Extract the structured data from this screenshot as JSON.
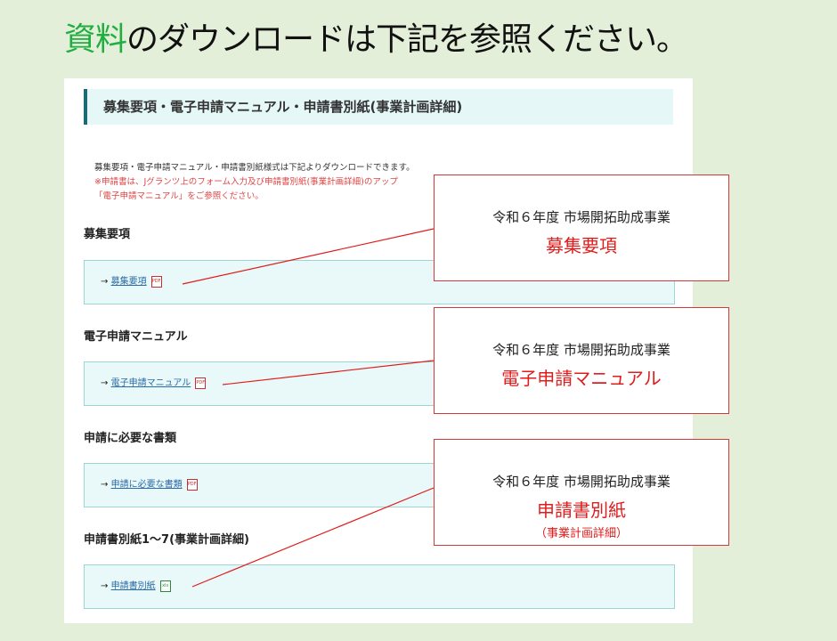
{
  "headline": {
    "accent": "資料",
    "rest": "のダウンロードは下記を参照ください。"
  },
  "panel": {
    "title": "募集要項・電子申請マニュアル・申請書別紙(事業計画詳細)",
    "intro_line1": "募集要項・電子申請マニュアル・申請書別紙様式は下記よりダウンロードできます。",
    "intro_line2": "※申請書は、Jグランツ上のフォーム入力及び申請書別紙(事業計画詳細)のアップ",
    "intro_line3": "「電子申請マニュアル」をご参照ください。",
    "groups": [
      {
        "heading": "募集要項",
        "arrow": "→",
        "link": "募集要項",
        "icon": "PDF"
      },
      {
        "heading": "電子申請マニュアル",
        "arrow": "→",
        "link": "電子申請マニュアル",
        "icon": "PDF"
      },
      {
        "heading": "申請に必要な書類",
        "arrow": "→",
        "link": "申請に必要な書類",
        "icon": "PDF"
      },
      {
        "heading": "申請書別紙1〜7(事業計画詳細)",
        "arrow": "→",
        "link": "申請書別紙",
        "icon": "xls"
      }
    ]
  },
  "callouts": [
    {
      "line1": "令和６年度 市場開拓助成事業",
      "line2": "募集要項",
      "line3": ""
    },
    {
      "line1": "令和６年度 市場開拓助成事業",
      "line2": "電子申請マニュアル",
      "line3": ""
    },
    {
      "line1": "令和６年度 市場開拓助成事業",
      "line2": "申請書別紙",
      "line3": "（事業計画詳細）"
    }
  ],
  "colors": {
    "accent": "#1fae3f",
    "callout_red": "#e01c1c",
    "box_fill": "#e9f8f8",
    "background": "#e3efd9"
  }
}
